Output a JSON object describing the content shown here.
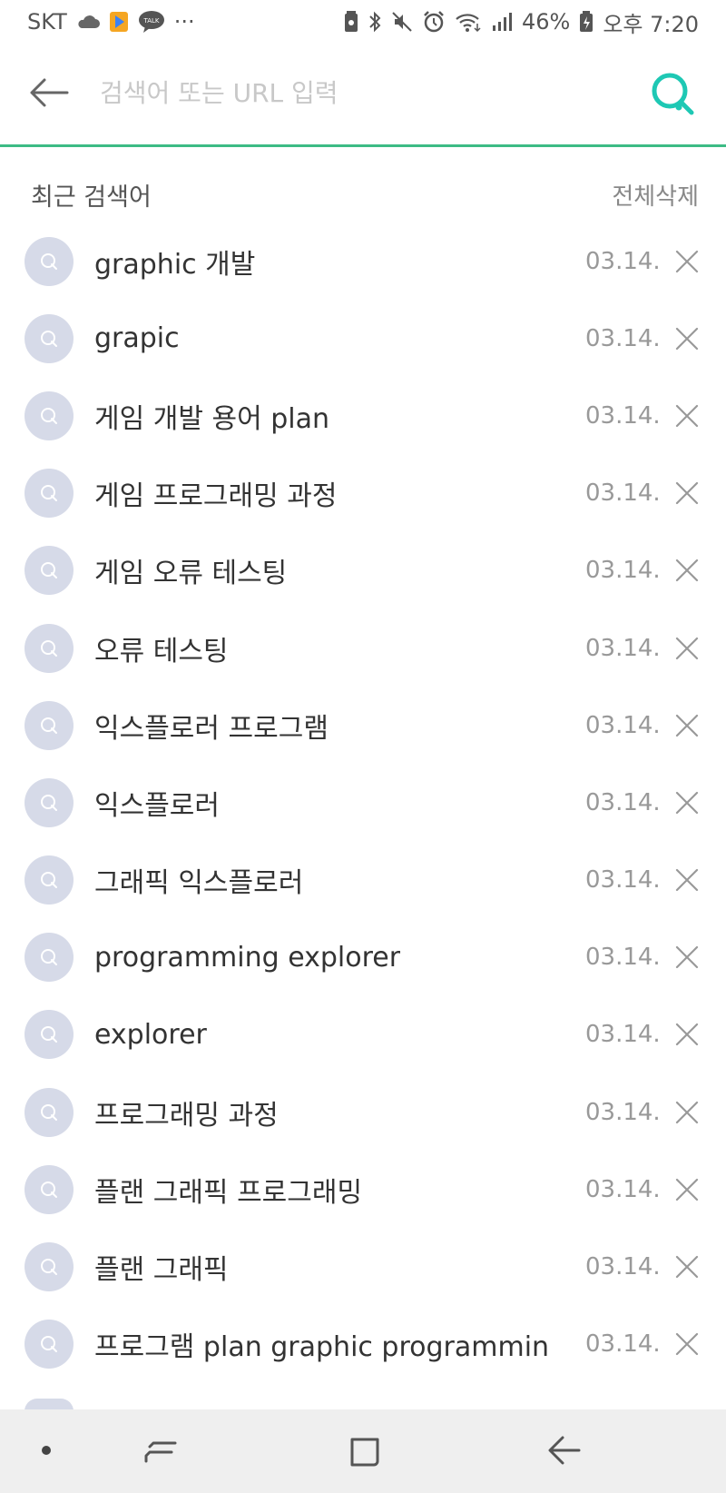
{
  "status_bar": {
    "carrier": "SKT",
    "talk_badge": "TALK",
    "more": "···",
    "battery_percent": "46%",
    "time": "오후 7:20"
  },
  "search": {
    "placeholder": "검색어 또는 URL 입력",
    "value": "",
    "accent_color": "#3dbb85"
  },
  "recent": {
    "title": "최근 검색어",
    "clear_all_label": "전체삭제",
    "items": [
      {
        "text": "graphic 개발",
        "date": "03.14."
      },
      {
        "text": "grapic",
        "date": "03.14."
      },
      {
        "text": "게임 개발 용어 plan",
        "date": "03.14."
      },
      {
        "text": "게임 프로그래밍 과정",
        "date": "03.14."
      },
      {
        "text": "게임 오류 테스팅",
        "date": "03.14."
      },
      {
        "text": "오류 테스팅",
        "date": "03.14."
      },
      {
        "text": "익스플로러 프로그램",
        "date": "03.14."
      },
      {
        "text": "익스플로러",
        "date": "03.14."
      },
      {
        "text": "그래픽 익스플로러",
        "date": "03.14."
      },
      {
        "text": "programming explorer",
        "date": "03.14."
      },
      {
        "text": "explorer",
        "date": "03.14."
      },
      {
        "text": "프로그래밍 과정",
        "date": "03.14."
      },
      {
        "text": "플랜 그래픽 프로그래밍",
        "date": "03.14."
      },
      {
        "text": "플랜 그래픽",
        "date": "03.14."
      },
      {
        "text": "프로그램 plan graphic programming",
        "date": "03.14."
      }
    ]
  },
  "icons": {
    "back": "back-arrow-icon",
    "search": "search-icon",
    "history": "history-search-icon",
    "delete": "close-icon"
  }
}
